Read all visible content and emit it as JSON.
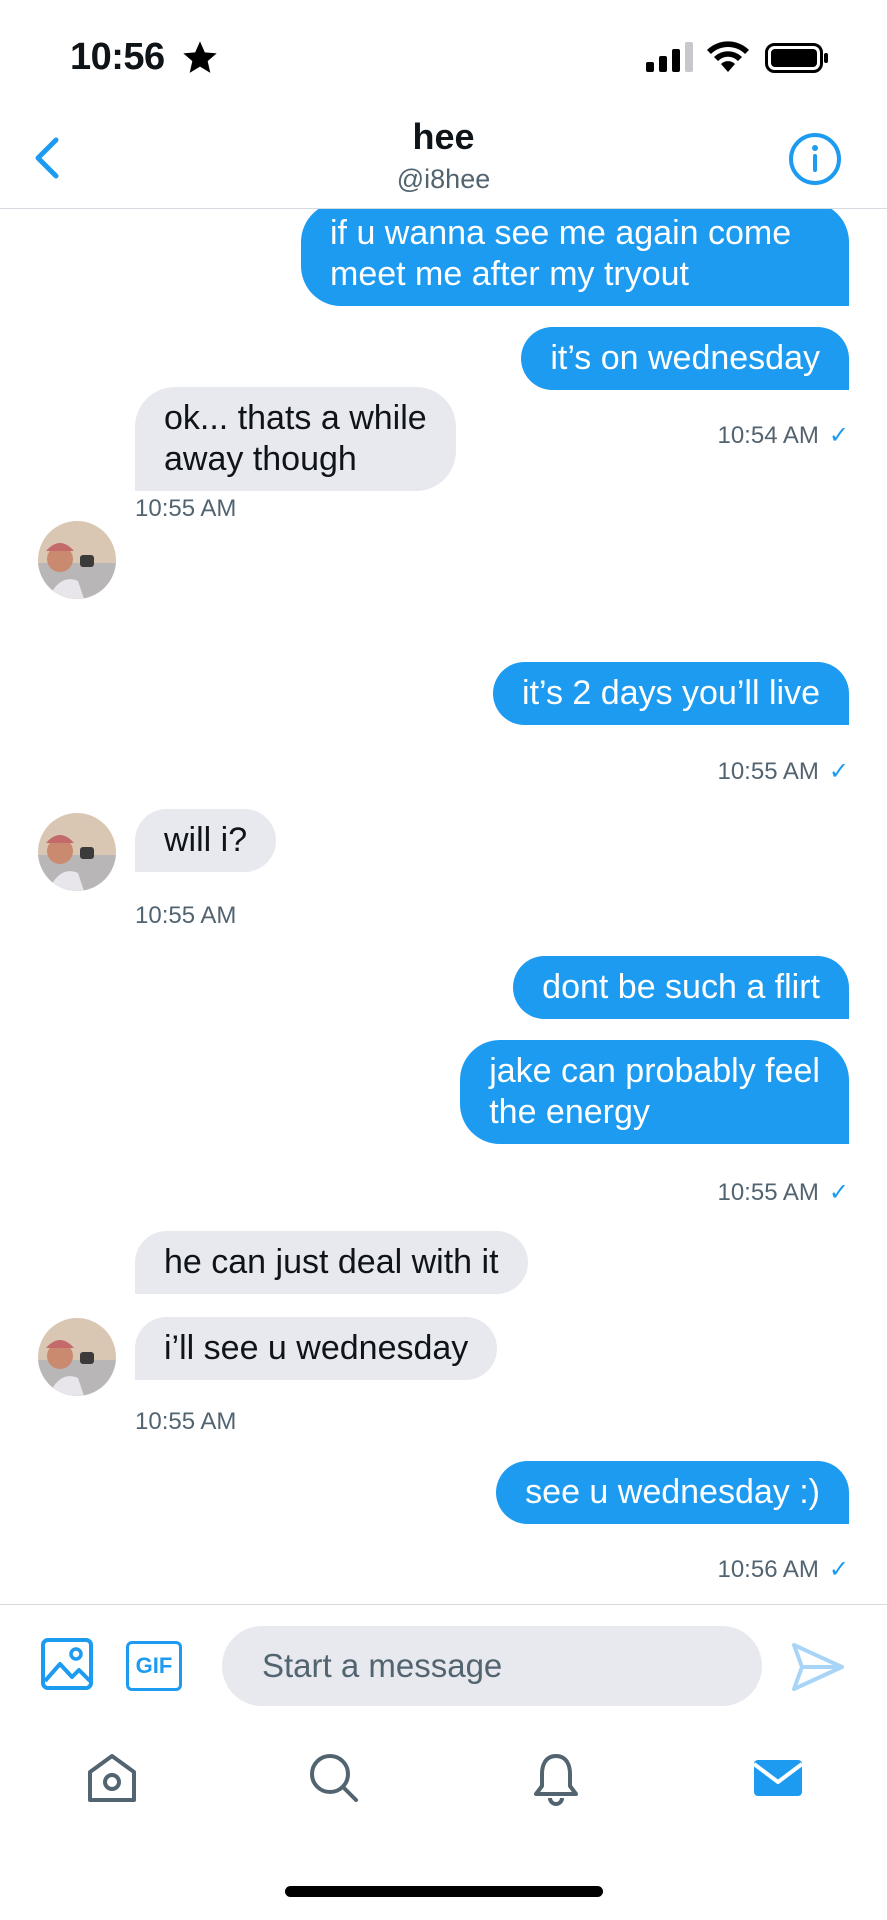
{
  "status": {
    "time": "10:56"
  },
  "header": {
    "title": "hee",
    "handle": "@i8hee"
  },
  "messages": [
    {
      "dir": "out",
      "text": "if u wanna see me again come\nmeet me after my tryout"
    },
    {
      "dir": "out",
      "text": "it’s on wednesday"
    },
    {
      "ts": "10:54 AM",
      "read_check": "✓"
    },
    {
      "dir": "in",
      "text": "ok... thats a while\naway though"
    },
    {
      "ts": "10:55 AM"
    },
    {
      "dir": "out",
      "text": "it’s 2 days you’ll live"
    },
    {
      "ts": "10:55 AM",
      "read_check": "✓"
    },
    {
      "dir": "in",
      "text": "will i?"
    },
    {
      "ts": "10:55 AM"
    },
    {
      "dir": "out",
      "text": "dont be such a flirt"
    },
    {
      "dir": "out",
      "text": "jake can probably feel\nthe energy"
    },
    {
      "ts": "10:55 AM",
      "read_check": "✓"
    },
    {
      "dir": "in",
      "text": "he can just deal with it"
    },
    {
      "dir": "in",
      "text": "i’ll see u wednesday"
    },
    {
      "ts": "10:55 AM"
    },
    {
      "dir": "out",
      "text": "see u wednesday :)"
    },
    {
      "ts": "10:56 AM",
      "read_check": "✓"
    }
  ],
  "composer": {
    "gif_label": "GIF",
    "placeholder": "Start a message",
    "value": ""
  },
  "tabs": [
    {
      "name": "home-icon"
    },
    {
      "name": "search-icon"
    },
    {
      "name": "notifications-icon"
    },
    {
      "name": "messages-icon",
      "active": true
    }
  ],
  "colors": {
    "accent": "#1d9bf0",
    "incoming_bubble": "#e7e9ee",
    "muted_text": "#536471"
  }
}
